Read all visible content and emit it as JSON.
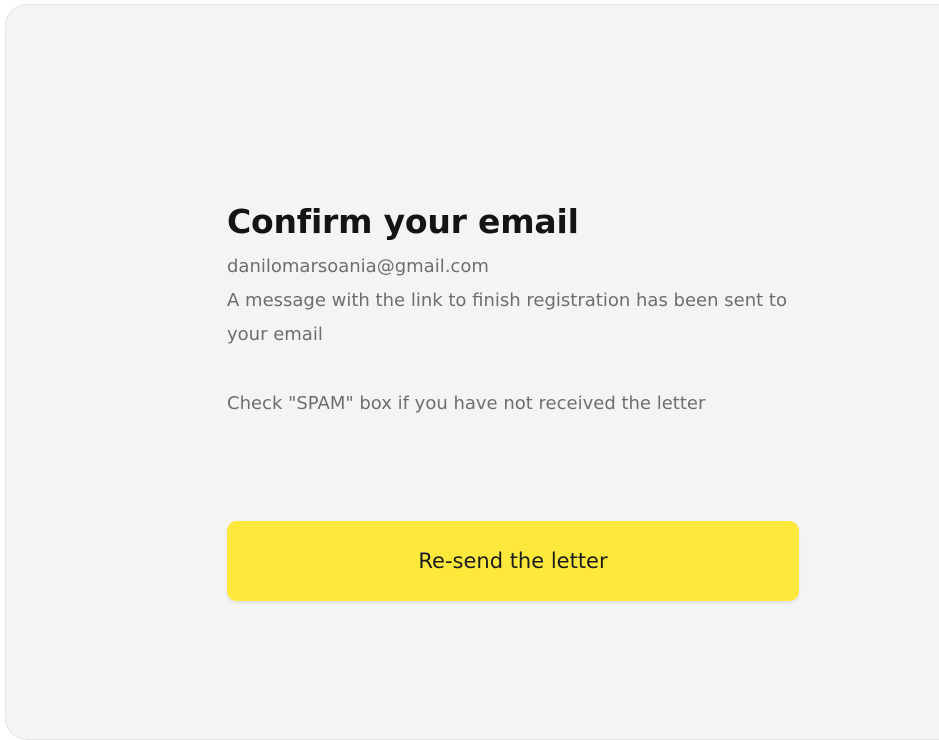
{
  "confirm_email": {
    "title": "Confirm your email",
    "email": "danilomarsoania@gmail.com",
    "message": "A message with the link to finish registration has been sent to your email",
    "spam_note": "Check \"SPAM\" box if you have not received the letter",
    "resend_button_label": "Re-send the letter"
  },
  "colors": {
    "card_background": "#f4f4f5",
    "button_background": "#fde83b",
    "title_text": "#141414",
    "body_text": "#6e6e72"
  }
}
